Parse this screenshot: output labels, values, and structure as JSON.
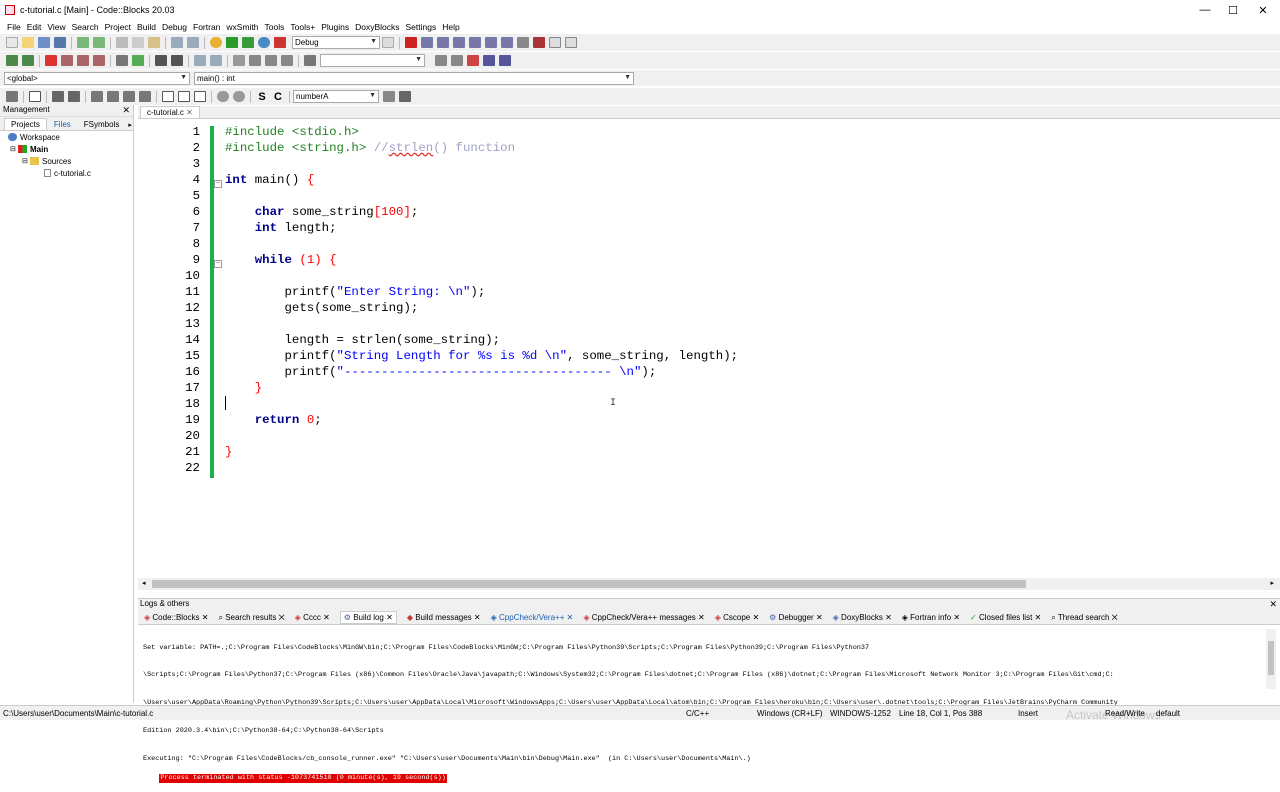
{
  "window": {
    "title": "c-tutorial.c [Main] - Code::Blocks 20.03",
    "minimize": "—",
    "maximize": "☐",
    "close": "✕"
  },
  "menu": [
    "File",
    "Edit",
    "View",
    "Search",
    "Project",
    "Build",
    "Debug",
    "Fortran",
    "wxSmith",
    "Tools",
    "Tools+",
    "Plugins",
    "DoxyBlocks",
    "Settings",
    "Help"
  ],
  "toolbar": {
    "build_target": "Debug",
    "scope": "<global>",
    "function": "main() : int",
    "symbol_search": "numberA"
  },
  "management": {
    "title": "Management",
    "tabs": [
      "Projects",
      "Files",
      "FSymbols"
    ],
    "tree": {
      "workspace": "Workspace",
      "project": "Main",
      "folder": "Sources",
      "file": "c-tutorial.c"
    }
  },
  "editor": {
    "tab": "c-tutorial.c",
    "line_numbers": [
      "1",
      "2",
      "3",
      "4",
      "5",
      "6",
      "7",
      "8",
      "9",
      "10",
      "11",
      "12",
      "13",
      "14",
      "15",
      "16",
      "17",
      "18",
      "19",
      "20",
      "21",
      "22"
    ]
  },
  "logs": {
    "title": "Logs & others",
    "tabs": [
      "Code::Blocks",
      "Search results",
      "Cccc",
      "Build log",
      "Build messages",
      "CppCheck/Vera++",
      "CppCheck/Vera++ messages",
      "Cscope",
      "Debugger",
      "DoxyBlocks",
      "Fortran info",
      "Closed files list",
      "Thread search"
    ],
    "lines": [
      "Set variable: PATH=.;C:\\Program Files\\CodeBlocks\\MinGW\\bin;C:\\Program Files\\CodeBlocks\\MinGW;C:\\Program Files\\Python39\\Scripts;C:\\Program Files\\Python39;C:\\Program Files\\Python37",
      "\\Scripts;C:\\Program Files\\Python37;C:\\Program Files (x86)\\Common Files\\Oracle\\Java\\javapath;C:\\Windows\\System32;C:\\Program Files\\dotnet;C:\\Program Files (x86)\\dotnet;C:\\Program Files\\Microsoft Network Monitor 3;C:\\Program Files\\Git\\cmd;C:",
      "\\Users\\user\\AppData\\Roaming\\Python\\Python39\\Scripts;C:\\Users\\user\\AppData\\Local\\Microsoft\\WindowsApps;C:\\Users\\user\\AppData\\Local\\atom\\bin;C:\\Program Files\\heroku\\bin;C:\\Users\\user\\.dotnet\\tools;C:\\Program Files\\JetBrains\\PyCharm Community",
      "Edition 2020.3.4\\bin\\;C:\\Python38-64;C:\\Python38-64\\Scripts",
      "Executing: \"C:\\Program Files\\CodeBlocks/cb_console_runner.exe\" \"C:\\Users\\user\\Documents\\Main\\bin\\Debug\\Main.exe\"  (in C:\\Users\\user\\Documents\\Main\\.)"
    ],
    "status_line": "Process terminated with status -1073741510 (0 minute(s), 19 second(s))"
  },
  "statusbar": {
    "path": "C:\\Users\\user\\Documents\\Main\\c-tutorial.c",
    "language": "C/C++",
    "eol": "Windows (CR+LF)",
    "encoding": "WINDOWS-1252",
    "position": "Line 18, Col 1, Pos 388",
    "mode": "Insert",
    "access": "Read/Write",
    "profile": "default",
    "watermark": "Activate Windows"
  },
  "colors": {
    "change_bar": "#1ab04a",
    "keyword": "#00008b",
    "preprocessor": "#218021",
    "string": "#0000ff",
    "number": "#ff0000",
    "error_highlight": "#e00000"
  }
}
